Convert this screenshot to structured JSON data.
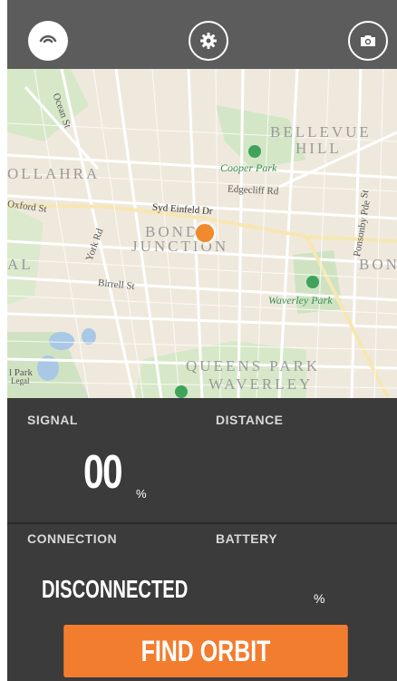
{
  "toolbar": {
    "left_icon": "orbit-logo-icon",
    "middle_icon": "gear-icon",
    "right_icon": "camera-icon"
  },
  "map": {
    "labels": {
      "bellevue": "BELLEVUE",
      "hill": "HILL",
      "woollahra": "OLLAHRA",
      "bondi": "BONDI",
      "junction": "JUNCTION",
      "bon": "BON",
      "queens_park": "QUEENS PARK",
      "waverley": "WAVERLEY",
      "al": "AL",
      "cooper_park": "Cooper Park",
      "waverley_park": "Waverley Park",
      "edgecliff_rd": "Edgecliff Rd",
      "syd_enfield": "Syd Einfeld Dr",
      "oxford_st": "Oxford St",
      "york_rd": "York Rd",
      "birrell_st": "Birrell St",
      "ocean_st": "Ocean St",
      "ponsonby": "Ponsonby Pde",
      "st_right": "St",
      "park_left": "l Park",
      "legal": "Legal"
    }
  },
  "signal": {
    "label": "SIGNAL",
    "value": "00",
    "unit": "%"
  },
  "distance": {
    "label": "DISTANCE"
  },
  "connection": {
    "label": "CONNECTION",
    "value": "DISCONNECTED"
  },
  "battery": {
    "label": "BATTERY",
    "unit": "%"
  },
  "actions": {
    "find_orbit": "FIND ORBIT"
  },
  "colors": {
    "accent": "#f37d2f",
    "panel": "#3b3b3b",
    "topbar": "#5c5c5c",
    "pin": "#f08a2c"
  }
}
